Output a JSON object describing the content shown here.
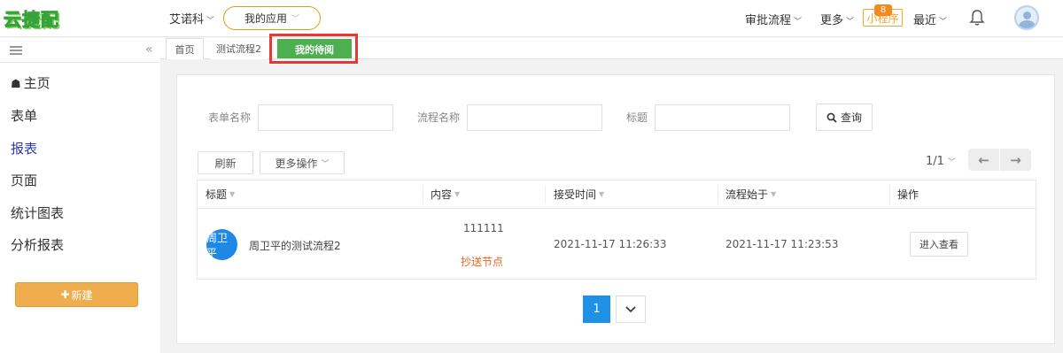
{
  "app": {
    "logo_text": "云捷配"
  },
  "topbar": {
    "tenant": "艾诺科",
    "my_app": "我的应用",
    "nav": [
      "审批流程",
      "更多",
      "最近"
    ],
    "mini_program": "小程序",
    "mini_badge": "8",
    "accent": "#d4a017"
  },
  "sidebar": {
    "items": [
      {
        "label": "主页",
        "active": false
      },
      {
        "label": "表单",
        "active": false
      },
      {
        "label": "报表",
        "active": true
      },
      {
        "label": "页面",
        "active": false
      },
      {
        "label": "统计图表",
        "active": false
      },
      {
        "label": "分析报表",
        "active": false
      }
    ],
    "new_button": "新建"
  },
  "tabs": [
    {
      "label": "首页"
    },
    {
      "label": "测试流程2"
    },
    {
      "label": "我的待阅",
      "active": true
    }
  ],
  "filters": {
    "form_name_label": "表单名称",
    "flow_name_label": "流程名称",
    "title_label": "标题",
    "form_name_value": "",
    "flow_name_value": "",
    "title_value": "",
    "query_button": "查询"
  },
  "toolbar": {
    "refresh": "刷新",
    "more_ops": "更多操作",
    "page_info": "1/1"
  },
  "table": {
    "headers": [
      "标题",
      "内容",
      "接受时间",
      "流程始于",
      "操作"
    ],
    "rows": [
      {
        "avatar_text": "周卫平",
        "title": "周卫平的测试流程2",
        "content": "111111",
        "tag": "抄送节点",
        "received_at": "2021-11-17 11:26:33",
        "started_at": "2021-11-17 11:23:53",
        "action": "进入查看"
      }
    ]
  },
  "pagination": {
    "current": "1"
  },
  "colors": {
    "active_tab": "#4caf50",
    "primary": "#1e90e6",
    "new_button": "#f0ad4e",
    "highlight": "#e53935"
  }
}
